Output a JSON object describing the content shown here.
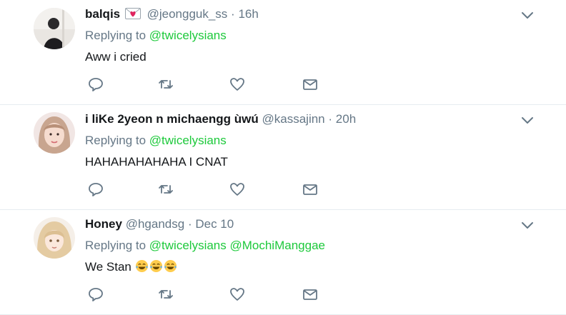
{
  "tweets": [
    {
      "name": "balqis",
      "handle": "@jeongguk_ss",
      "separator": "·",
      "time": "16h",
      "replying_label": "Replying to",
      "mentions": [
        "@twicelysians"
      ],
      "text": "Aww i cried",
      "has_flag": true
    },
    {
      "name": "i liKe 2yeon n michaengg ùwú",
      "handle": "@kassajinn",
      "separator": "·",
      "time": "20h",
      "replying_label": "Replying to",
      "mentions": [
        "@twicelysians"
      ],
      "text": "HAHAHAHAHAHA I CNAT",
      "has_flag": false
    },
    {
      "name": "Honey",
      "handle": "@hgandsg",
      "separator": "·",
      "time": "Dec 10",
      "replying_label": "Replying to",
      "mentions": [
        "@twicelysians",
        "@MochiManggae"
      ],
      "text": "We Stan",
      "emojis": [
        "face-with-tears-of-joy",
        "face-with-tears-of-joy",
        "face-with-tears-of-joy"
      ],
      "has_flag": false
    }
  ],
  "actions": [
    "reply-icon",
    "retweet-icon",
    "like-icon",
    "direct-message-icon"
  ],
  "colors": {
    "mention": "#1dc93b",
    "secondary": "#657786",
    "divider": "#e6ecf0",
    "icon": "#657786"
  }
}
